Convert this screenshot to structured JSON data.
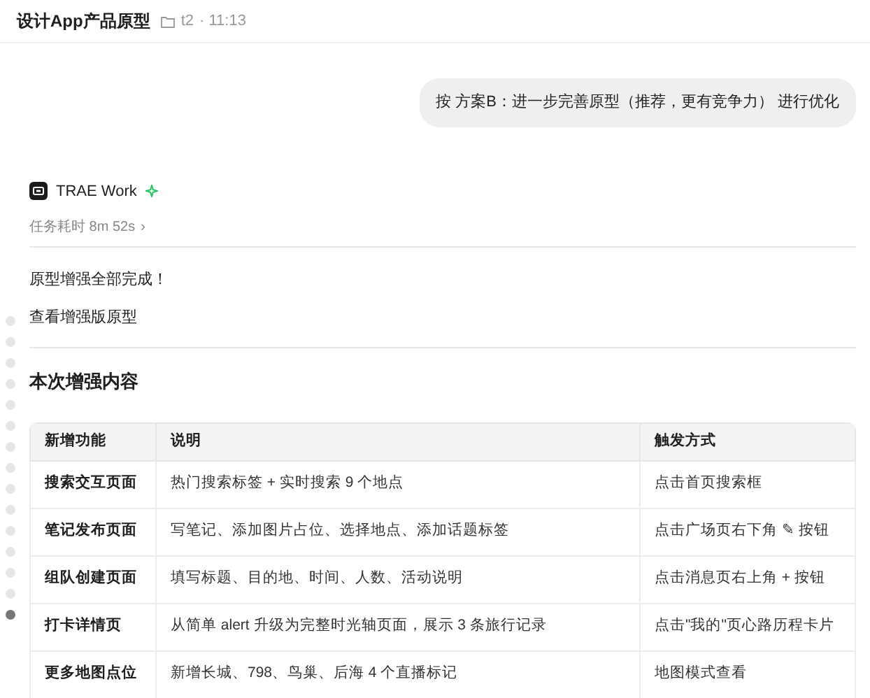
{
  "header": {
    "title": "设计App产品原型",
    "folder": "t2",
    "time": "· 11:13"
  },
  "user_message": "按 方案B：进一步完善原型（推荐，更有竞争力） 进行优化",
  "agent": {
    "name": "TRAE Work",
    "duration": "任务耗时 8m 52s",
    "chevron": "›"
  },
  "paragraphs": [
    "原型增强全部完成！",
    "查看增强版原型"
  ],
  "section_title": "本次增强内容",
  "table": {
    "columns": [
      "新增功能",
      "说明",
      "触发方式"
    ],
    "rows": [
      [
        "搜索交互页面",
        "热门搜索标签 + 实时搜索 9 个地点",
        "点击首页搜索框"
      ],
      [
        "笔记发布页面",
        "写笔记、添加图片占位、选择地点、添加话题标签",
        "点击广场页右下角 ✎ 按钮"
      ],
      [
        "组队创建页面",
        "填写标题、目的地、时间、人数、活动说明",
        "点击消息页右上角 + 按钮"
      ],
      [
        "打卡详情页",
        "从简单 alert 升级为完整时光轴页面，展示 3 条旅行记录",
        "点击\"我的\"页心路历程卡片"
      ],
      [
        "更多地图点位",
        "新增长城、798、鸟巢、后海 4 个直播标记",
        "地图模式查看"
      ]
    ]
  },
  "nav_dots": [
    {
      "selected": false
    },
    {
      "selected": false
    },
    {
      "selected": false
    },
    {
      "selected": false
    },
    {
      "selected": false
    },
    {
      "selected": false
    },
    {
      "selected": false
    },
    {
      "selected": false
    },
    {
      "selected": false
    },
    {
      "selected": false
    },
    {
      "selected": false
    },
    {
      "selected": false
    },
    {
      "selected": false
    },
    {
      "selected": false
    },
    {
      "selected": true
    }
  ]
}
